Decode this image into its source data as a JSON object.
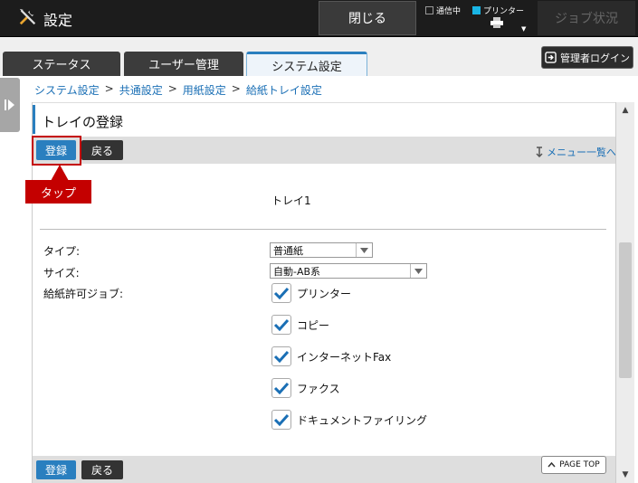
{
  "header": {
    "title": "設定",
    "close_label": "閉じる",
    "status_comm": "通信中",
    "status_printer": "プリンター",
    "job_status": "ジョブ状況",
    "settings_icon": "wrench-screwdriver-icon"
  },
  "tabs": [
    {
      "label": "ステータス",
      "active": false
    },
    {
      "label": "ユーザー管理",
      "active": false
    },
    {
      "label": "システム設定",
      "active": true
    }
  ],
  "admin_login": "管理者ログイン",
  "breadcrumb": [
    "システム設定",
    "共通設定",
    "用紙設定",
    "給紙トレイ設定"
  ],
  "breadcrumb_sep": ">",
  "page": {
    "title": "トレイの登録",
    "register_label": "登録",
    "back_label": "戻る",
    "menu_link": "メニュー一覧へ",
    "callout": "タップ",
    "tray_name": "トレイ1"
  },
  "fields": {
    "type_label": "タイプ:",
    "type_value": "普通紙",
    "size_label": "サイズ:",
    "size_value": "自動-AB系",
    "jobs_label": "給紙許可ジョブ:"
  },
  "jobs": [
    {
      "label": "プリンター",
      "checked": true
    },
    {
      "label": "コピー",
      "checked": true
    },
    {
      "label": "インターネットFax",
      "checked": true
    },
    {
      "label": "ファクス",
      "checked": true
    },
    {
      "label": "ドキュメントファイリング",
      "checked": true
    }
  ],
  "page_top": "PAGE TOP",
  "colors": {
    "accent": "#2a7fbf",
    "callout": "#c40000",
    "topbar": "#1c1c1c",
    "check": "#1a6fb5"
  }
}
